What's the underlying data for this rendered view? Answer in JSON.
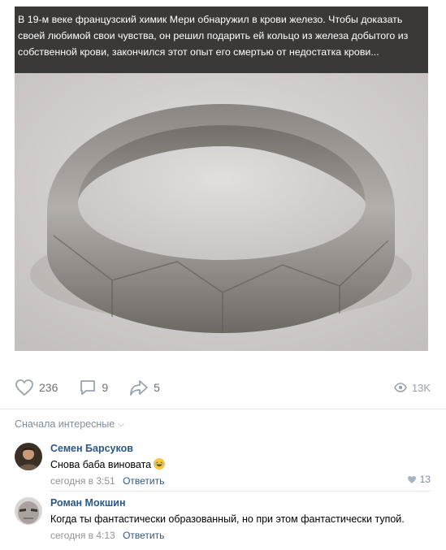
{
  "post": {
    "caption": "В 19-м веке французский химик Мери обнаружил в крови железо. Чтобы доказать\nсвоей любимой свои чувства, он решил подарить ей кольцо из железа добытого из\nсобственной крови, закончился этот опыт его смертью от недостатка крови...",
    "photo_icon": "iron-ring-photo"
  },
  "actions": {
    "likes": "236",
    "comments": "9",
    "reposts": "5",
    "views": "13K",
    "like_icon": "heart-icon",
    "comment_icon": "comment-icon",
    "share_icon": "share-icon",
    "views_icon": "eye-icon"
  },
  "comments_section": {
    "sort_label": "Сначала интересные",
    "items": [
      {
        "author": "Семен Барсуков",
        "text": "Снова баба виновата",
        "emoji": "laughing-emoji",
        "time": "сегодня в 3:51",
        "reply_label": "Ответить",
        "likes": "13"
      },
      {
        "author": "Роман Мокшин",
        "text": "Когда ты фантастически образованный, но при этом фантастически тупой.",
        "time": "сегодня в 4:13",
        "reply_label": "Ответить"
      }
    ]
  },
  "colors": {
    "link": "#2a5885",
    "muted": "#818c99",
    "caption_bg": "#3a3938"
  }
}
